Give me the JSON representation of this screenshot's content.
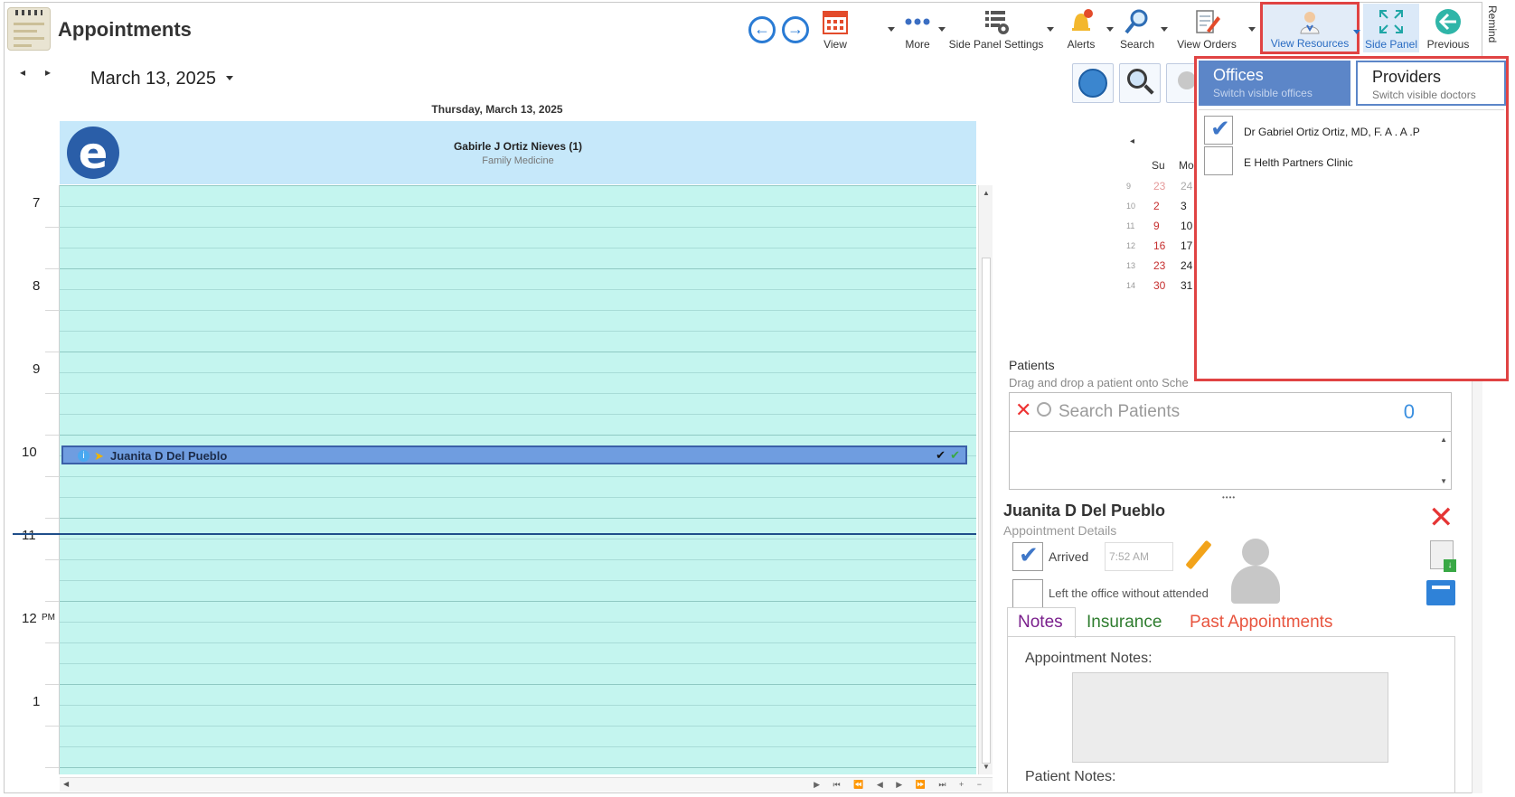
{
  "app": {
    "title": "Appointments"
  },
  "toolbar": {
    "view": "View",
    "more": "More",
    "side_panel_settings": "Side Panel Settings",
    "alerts": "Alerts",
    "search": "Search",
    "view_orders": "View Orders",
    "view_resources": "View Resources",
    "side_panel": "Side Panel",
    "previous": "Previous",
    "remind": "Remind"
  },
  "colors": {
    "accent": "#2a7bd4",
    "highlight_border": "#e04343",
    "grid_background": "#c4f5ef",
    "appointment": "#6f9de0",
    "provider_header": "#c6e8fa"
  },
  "scheduler": {
    "date_label": "March 13, 2025",
    "day_heading": "Thursday, March 13, 2025",
    "provider": {
      "name": "Gabirle J Ortiz Nieves (1)",
      "specialty": "Family Medicine"
    },
    "hours": [
      "7",
      "8",
      "9",
      "10",
      "11",
      "12",
      "1"
    ],
    "pm_marker": "PM",
    "appointment": {
      "patient": "Juanita D Del Pueblo",
      "check_1": "✔",
      "check_2": "✔"
    }
  },
  "mini_calendar": {
    "headers": [
      "Su",
      "Mo"
    ],
    "weeks": [
      {
        "week": "9",
        "days": [
          "23",
          "24"
        ]
      },
      {
        "week": "10",
        "days": [
          "2",
          "3"
        ]
      },
      {
        "week": "11",
        "days": [
          "9",
          "10"
        ]
      },
      {
        "week": "12",
        "days": [
          "16",
          "17"
        ]
      },
      {
        "week": "13",
        "days": [
          "23",
          "24"
        ]
      },
      {
        "week": "14",
        "days": [
          "30",
          "31"
        ]
      }
    ]
  },
  "patients": {
    "title": "Patients",
    "hint": "Drag and drop a patient onto Sche",
    "search_placeholder": "Search Patients",
    "count": "0"
  },
  "details": {
    "patient_name": "Juanita D Del Pueblo",
    "subtitle": "Appointment Details",
    "arrived_label": "Arrived",
    "arrived_checked": true,
    "arrived_time": "7:52 AM",
    "left_office_label": "Left the office without attended",
    "left_office_checked": false,
    "tabs": [
      {
        "label": "Notes",
        "color": "#7a1f8c"
      },
      {
        "label": "Insurance",
        "color": "#2f7d2f"
      },
      {
        "label": "Past Appointments",
        "color": "#e8543e"
      }
    ],
    "appointment_notes_label": "Appointment Notes:",
    "patient_notes_label": "Patient Notes:"
  },
  "resources_popup": {
    "tabs": [
      {
        "title": "Offices",
        "subtitle": "Switch visible offices",
        "active": true
      },
      {
        "title": "Providers",
        "subtitle": "Switch visible doctors",
        "active": false
      }
    ],
    "items": [
      {
        "name": "Dr Gabriel Ortiz Ortiz, MD, F. A . A .P",
        "checked": true
      },
      {
        "name": "E Helth Partners Clinic",
        "checked": false
      }
    ]
  }
}
